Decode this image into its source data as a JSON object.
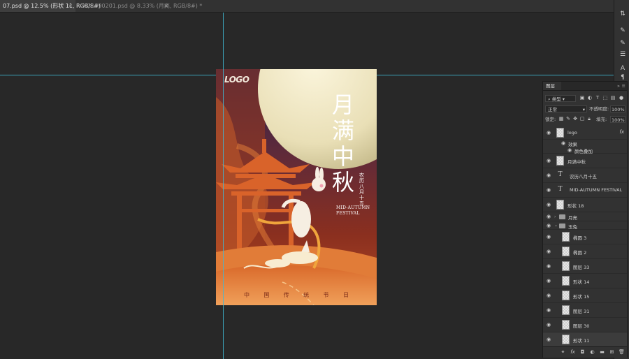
{
  "tabs": [
    {
      "label": "07.psd @ 12.5% (形状 11, RGB/8#)",
      "active": true
    },
    {
      "label": "2021090201.psd @ 8.33% (月亮, RGB/8#) *",
      "active": false
    }
  ],
  "tab_close": "×",
  "poster": {
    "logo": "LOGO",
    "title_chars": [
      "月",
      "满",
      "中",
      "秋"
    ],
    "lunar_date": "农历八月十五",
    "en_line1": "MID-AUTUMN",
    "en_line2": "FESTIVAL",
    "bottom_chars": [
      "中",
      "国",
      "传",
      "统",
      "节",
      "日"
    ]
  },
  "colors": {
    "accent_guide": "#3fb9d3",
    "poster_red": "#8a2f1f",
    "moon": "#efe7c6",
    "panel_bg": "#323232"
  },
  "layers_panel": {
    "tab_label": "图层",
    "collapse_icon": "»",
    "menu_icon": "≡",
    "filter_label": "类型",
    "blend_mode": "正常",
    "opacity_label": "不透明度:",
    "opacity_value": "100%",
    "lock_label": "锁定:",
    "fill_label": "填充:",
    "fill_value": "100%",
    "layers": [
      {
        "name": "logo",
        "type": "smart",
        "fx": "fx",
        "indent": 0
      },
      {
        "name": "效果",
        "type": "effect",
        "indent": 1
      },
      {
        "name": "颜色叠加",
        "type": "effect",
        "indent": 2
      },
      {
        "name": "月满中秋",
        "type": "smart",
        "indent": 0
      },
      {
        "name": "农历八月十五",
        "type": "text",
        "indent": 0
      },
      {
        "name": "MID-AUTUMN FESTIVAL",
        "type": "text",
        "indent": 0
      },
      {
        "name": "形状 18",
        "type": "shape",
        "indent": 0
      },
      {
        "name": "月亮",
        "type": "group",
        "expanded": false,
        "indent": 0
      },
      {
        "name": "玉兔",
        "type": "group",
        "expanded": true,
        "indent": 0
      },
      {
        "name": "椭圆 3",
        "type": "shape",
        "indent": 1
      },
      {
        "name": "椭圆 2",
        "type": "shape",
        "indent": 1
      },
      {
        "name": "图层 33",
        "type": "pixel",
        "indent": 1
      },
      {
        "name": "形状 14",
        "type": "shape",
        "indent": 1
      },
      {
        "name": "形状 15",
        "type": "shape",
        "indent": 1
      },
      {
        "name": "图层 31",
        "type": "pixel",
        "indent": 1
      },
      {
        "name": "图层 30",
        "type": "pixel",
        "indent": 1
      },
      {
        "name": "形状 11",
        "type": "shape",
        "indent": 1
      }
    ]
  }
}
